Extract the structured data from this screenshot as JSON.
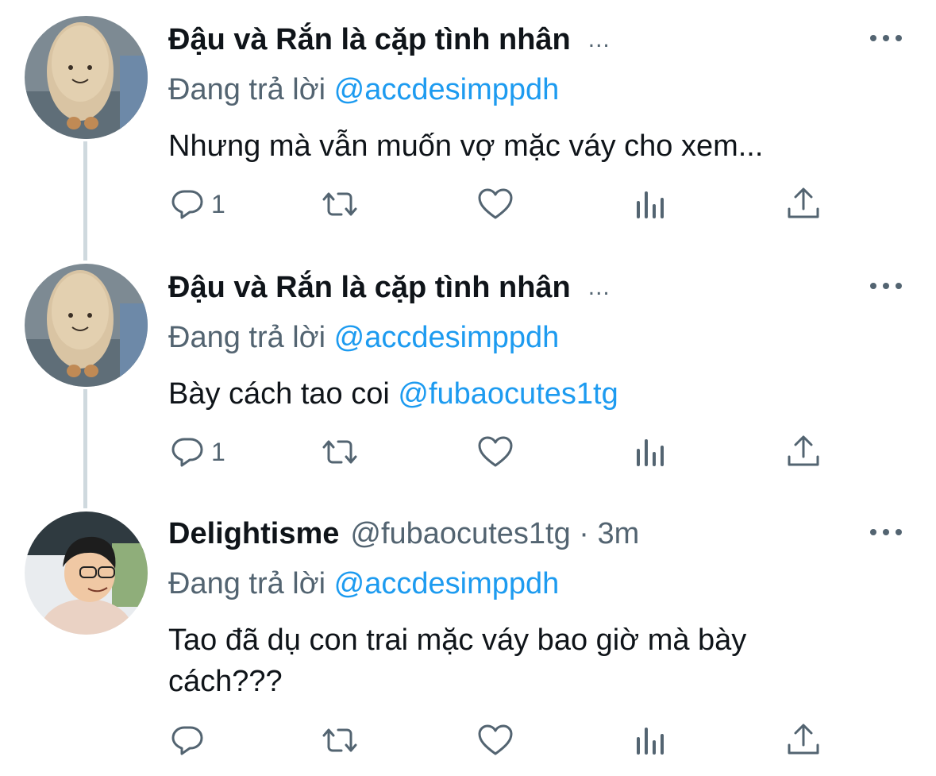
{
  "tweets": [
    {
      "name": "Đậu và Rắn là cặp tình nhân",
      "name_suffix": "...",
      "reply_prefix": "Đang trả lời",
      "reply_handle": "@accdesimppdh",
      "text": "Nhưng mà vẫn muốn vợ mặc váy cho xem...",
      "reply_count": "1",
      "avatar": "plush-toy-avatar"
    },
    {
      "name": "Đậu và Rắn là cặp tình nhân",
      "name_suffix": "...",
      "reply_prefix": "Đang trả lời",
      "reply_handle": "@accdesimppdh",
      "text_plain": "Bày cách tao coi",
      "text_mention": "@fubaocutes1tg",
      "reply_count": "1",
      "avatar": "plush-toy-avatar"
    },
    {
      "name": "Delightisme",
      "handle_time": "@fubaocutes1tg · 3m",
      "reply_prefix": "Đang trả lời",
      "reply_handle": "@accdesimppdh",
      "text_line1": "Tao đã dụ con trai mặc váy bao giờ mà bày",
      "text_line2": "cách???",
      "reply_count": "",
      "avatar": "person-avatar"
    }
  ],
  "icons": [
    "reply-icon",
    "retweet-icon",
    "like-icon",
    "analytics-icon",
    "share-icon",
    "more-icon"
  ],
  "colors": {
    "text": "#0f1419",
    "secondary": "#536471",
    "link": "#1d9bf0",
    "thread_line": "#cfd9de"
  }
}
